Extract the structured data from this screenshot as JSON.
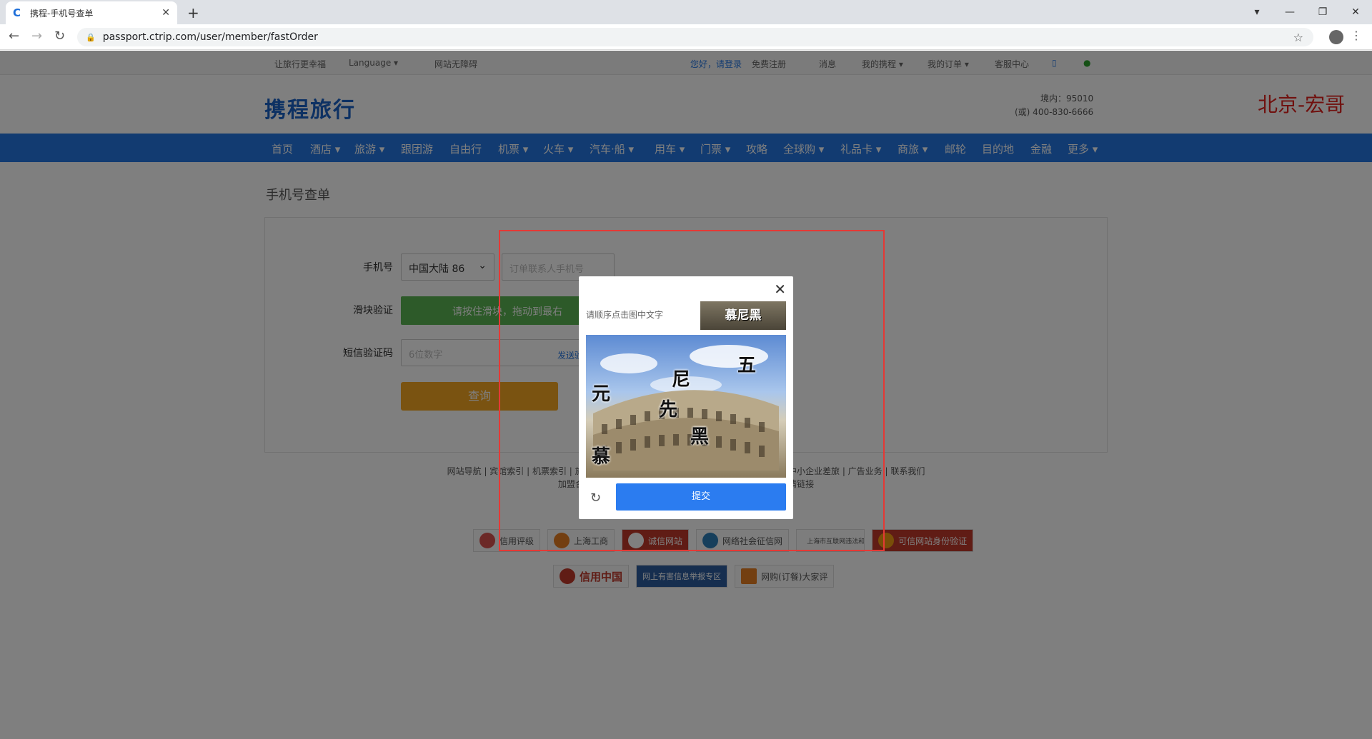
{
  "browser": {
    "tab_title": "携程-手机号查单",
    "url": "passport.ctrip.com/user/member/fastOrder",
    "new_tab": "+"
  },
  "topbar": {
    "slogan": "让旅行更幸福",
    "language": "Language ▾",
    "accessible": "网站无障碍",
    "login": "您好，请登录",
    "register": "免费注册",
    "messages": "消息",
    "my_trip": "我的携程 ▾",
    "my_orders": "我的订单 ▾",
    "service": "客服中心"
  },
  "header": {
    "logo_text": "携程旅行",
    "hotline_domestic": "境内：95010",
    "hotline_alt": "(或) 400-830-6666",
    "watermark": "北京-宏哥"
  },
  "nav": {
    "items": [
      "首页",
      "酒店 ▾",
      "旅游 ▾",
      "跟团游",
      "自由行",
      "机票 ▾",
      "火车 ▾",
      "汽车·船 ▾",
      "用车 ▾",
      "门票 ▾",
      "攻略",
      "全球购 ▾",
      "礼品卡 ▾",
      "商旅 ▾",
      "邮轮",
      "目的地",
      "金融",
      "更多 ▾"
    ]
  },
  "form": {
    "page_title": "手机号查单",
    "phone_label": "手机号",
    "country_value": "中国大陆 86",
    "phone_placeholder": "订单联系人手机号",
    "slider_label": "滑块验证",
    "slider_text": "请按住滑块，拖动到最右",
    "sms_label": "短信验证码",
    "sms_placeholder": "6位数字",
    "send_code": "发送验证码",
    "query_button": "查询"
  },
  "footer": {
    "links_line1": "网站导航 | 宾馆索引 | 机票索引 | 旅游索引 | 商旅索引 | 攻略索引 | 代理合作 | 企业商旅 | 中小企业差旅 | 广告业务 | 联系我们",
    "links_line2": "加盟合作 | 酒店加盟 | 目的地 | 旅游度假资质 | 保险代理 | 友情链接",
    "copyright": "Copyright©1999-2021 | 沪ICP备08023580号",
    "police": "沪公网安备 | 旅游度假资质",
    "badges_row1": [
      "信用评级",
      "上海工商",
      "诚信网站",
      "网络社会征信网",
      "上海市互联网违法和不良信息举报中心",
      "可信网站身份验证"
    ],
    "badges_row2": [
      "信用中国",
      "网上有害信息举报专区",
      "网购(订餐)大家评"
    ]
  },
  "captcha": {
    "instruction": "请顺序点击图中文字",
    "target_text": "慕尼黑",
    "chars": [
      "五",
      "尼",
      "元",
      "先",
      "黑",
      "慕"
    ],
    "submit": "提交"
  }
}
